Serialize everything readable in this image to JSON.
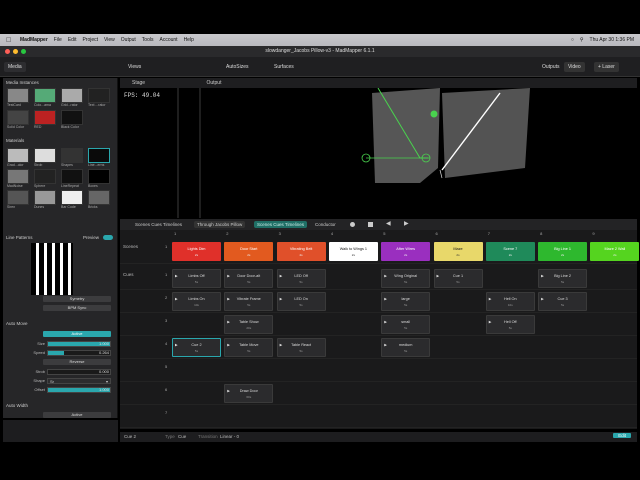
{
  "menubar": {
    "app": "MadMapper",
    "items": [
      "File",
      "Edit",
      "Project",
      "View",
      "Output",
      "Tools",
      "Account",
      "Help"
    ],
    "clock": "Thu Apr 30  1:36 PM"
  },
  "window": {
    "title": "slowdanger_Jacobs Pillow-v3 - MadMapper 6.1.1"
  },
  "toolbar": {
    "media": "Media",
    "views": "Views",
    "autoSizes": "AutoSizes",
    "surfaces": "Surfaces",
    "outputs": "Outputs",
    "video": "Video",
    "laser": "+ Laser"
  },
  "left": {
    "media_header": "Media Instances",
    "media_items": [
      {
        "label": "TestCard"
      },
      {
        "label": "Colo...ama"
      },
      {
        "label": "Grid...rator"
      },
      {
        "label": "Text ...rator"
      },
      {
        "label": "Solid Color"
      },
      {
        "label": "RED"
      },
      {
        "label": "Black Color"
      }
    ],
    "materials_header": "Materials",
    "material_items": [
      {
        "label": "Grad...olor"
      },
      {
        "label": "Strob"
      },
      {
        "label": "Shapes"
      },
      {
        "label": "Line...erns"
      },
      {
        "label": "MadNoise"
      },
      {
        "label": "Sphere"
      },
      {
        "label": "LineRepeat"
      },
      {
        "label": "Boxes"
      },
      {
        "label": "Siren"
      },
      {
        "label": "Dunes"
      },
      {
        "label": "Bar Code"
      },
      {
        "label": "Bricks"
      }
    ],
    "preview_title": "Line Patterns",
    "preview_label": "Preview",
    "symetry": "Symetry",
    "bpm_sync": "BPM Sync",
    "auto_move": "Auto Move",
    "active": "Active",
    "size_label": "Size",
    "size_value": "1.000",
    "size_fraction": 1.0,
    "speed_label": "Speed",
    "speed_value": "0.264",
    "speed_fraction": 0.26,
    "reverse": "Reverse",
    "strob_label": "Strob",
    "strob_value": "0.000",
    "shape_label": "Shape",
    "shape_value": "Sr",
    "offset_label": "Offset",
    "offset_value": "1.000",
    "offset_fraction": 1.0,
    "auto_width": "Auto Width",
    "active2": "Active"
  },
  "stage": {
    "title": "Stage",
    "output_label": "Output",
    "fps": "FPS: 49.04"
  },
  "cues": {
    "tabs": [
      "Scenes Cues Timelines",
      "Through Jacobs Pillow",
      "Scenes Cues Timelines",
      "Conductor"
    ],
    "columns": [
      "1",
      "2",
      "3",
      "4",
      "5",
      "6",
      "7",
      "8",
      "9"
    ],
    "scenes_label": "Scenes",
    "cues_label": "Cues",
    "scenes": [
      {
        "name": "Lights Dim",
        "dur": "2s",
        "color": "#e0302a"
      },
      {
        "name": "Door Start",
        "dur": "2s",
        "color": "#e25a1f"
      },
      {
        "name": "Vibrating Belt",
        "dur": "2s",
        "color": "#e0502a"
      },
      {
        "name": "Walk to Wings 1",
        "dur": "2s",
        "color": "#ffffff"
      },
      {
        "name": "After Wires",
        "dur": "2s",
        "color": "#9a2fbf"
      },
      {
        "name": "Maze",
        "dur": "2s",
        "color": "#e8d86a"
      },
      {
        "name": "Scene 7",
        "dur": "2s",
        "color": "#1f8a5a"
      },
      {
        "name": "Big Line 1",
        "dur": "2s",
        "color": "#2eb82e"
      },
      {
        "name": "Maze 2 Wall",
        "dur": "2s",
        "color": "#55d41f"
      }
    ],
    "rows": [
      {
        "num": "1",
        "cells": [
          {
            "col": 0,
            "name": "Limbs Off",
            "dur": "5s"
          },
          {
            "col": 1,
            "name": "Door Door-alt",
            "dur": "5s"
          },
          {
            "col": 2,
            "name": "LED Off",
            "dur": "5s"
          },
          {
            "col": 4,
            "name": "Wing Original",
            "dur": "5s"
          },
          {
            "col": 5,
            "name": "Cue 1",
            "dur": "5s"
          },
          {
            "col": 7,
            "name": "Big Line 2",
            "dur": "5s"
          }
        ]
      },
      {
        "num": "2",
        "cells": [
          {
            "col": 0,
            "name": "Limbs On",
            "dur": "10s"
          },
          {
            "col": 1,
            "name": "Vibrate Frame",
            "dur": "5s"
          },
          {
            "col": 2,
            "name": "LED On",
            "dur": "5s"
          },
          {
            "col": 4,
            "name": "large",
            "dur": "5s"
          },
          {
            "col": 6,
            "name": "Hell On",
            "dur": "10s"
          },
          {
            "col": 7,
            "name": "Cue 3",
            "dur": "5s"
          }
        ]
      },
      {
        "num": "3",
        "cells": [
          {
            "col": 1,
            "name": "Table Show",
            "dur": "20s"
          },
          {
            "col": 4,
            "name": "small",
            "dur": "5s"
          },
          {
            "col": 6,
            "name": "Hell Off",
            "dur": "5s"
          }
        ]
      },
      {
        "num": "4",
        "cells": [
          {
            "col": 0,
            "name": "Cue 2",
            "dur": "5s",
            "selected": true
          },
          {
            "col": 1,
            "name": "Table Move",
            "dur": "5s"
          },
          {
            "col": 2,
            "name": "Table React",
            "dur": "5s"
          },
          {
            "col": 4,
            "name": "medium",
            "dur": "5s"
          }
        ]
      },
      {
        "num": "5",
        "cells": []
      },
      {
        "num": "6",
        "cells": [
          {
            "col": 1,
            "name": "Draw Door",
            "dur": "60s"
          }
        ]
      },
      {
        "num": "7",
        "cells": []
      }
    ]
  },
  "status": {
    "cue": "Cue 2",
    "type_label": "Type",
    "type_value": "Cue",
    "transition_label": "Transition",
    "transition_value": "Linear - 0",
    "edit": "Edit"
  }
}
